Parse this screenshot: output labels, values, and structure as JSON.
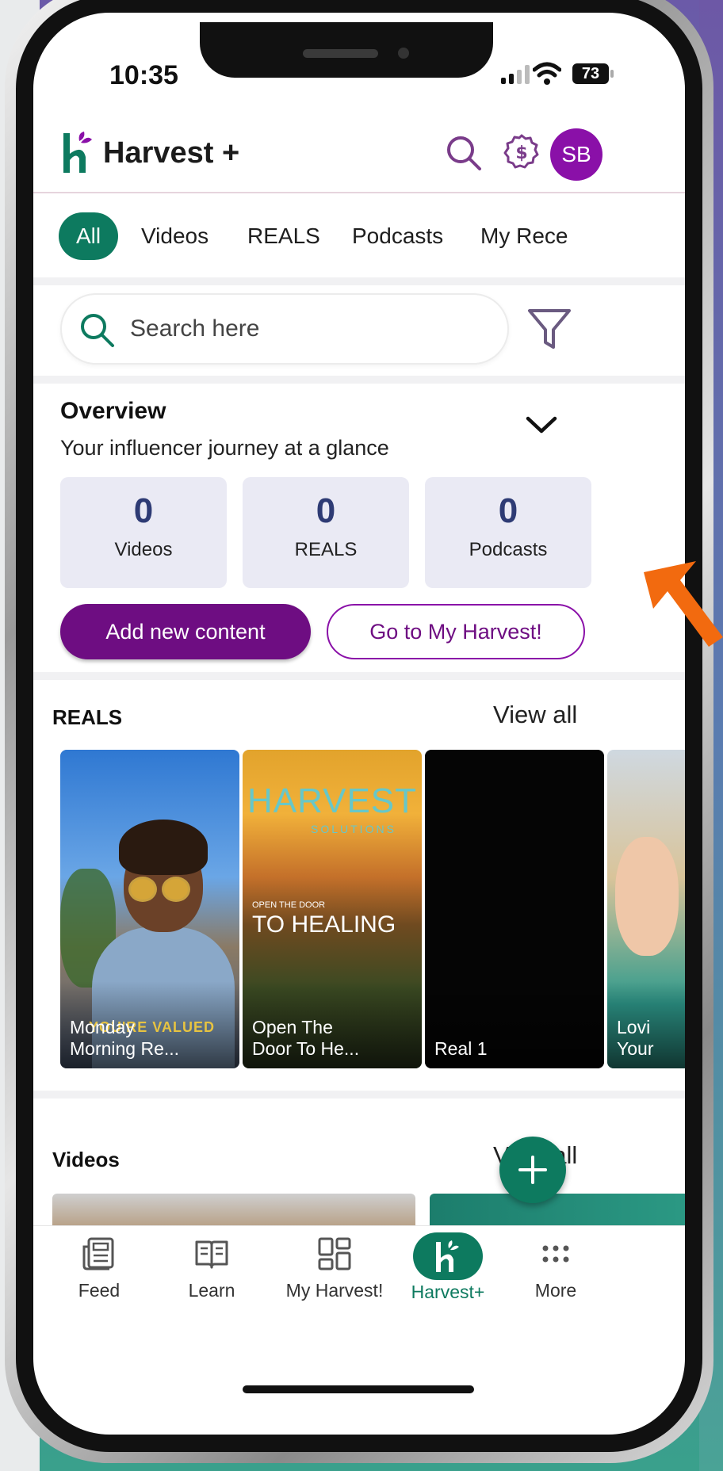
{
  "status_bar": {
    "time": "10:35",
    "battery": "73"
  },
  "header": {
    "title": "Harvest +",
    "avatar_initials": "SB"
  },
  "tabs": [
    {
      "label": "All",
      "active": true
    },
    {
      "label": "Videos"
    },
    {
      "label": "REALS"
    },
    {
      "label": "Podcasts"
    },
    {
      "label": "My Recei"
    }
  ],
  "search": {
    "placeholder": "Search here"
  },
  "overview": {
    "title": "Overview",
    "subtitle": "Your influencer journey at a glance",
    "stats": [
      {
        "value": "0",
        "label": "Videos"
      },
      {
        "value": "0",
        "label": "REALS"
      },
      {
        "value": "0",
        "label": "Podcasts"
      }
    ],
    "primary_button": "Add new content",
    "secondary_button": "Go to My Harvest!"
  },
  "reals": {
    "title": "REALS",
    "view_all": "View all",
    "cards": [
      {
        "caption": "Monday\nMorning Re...",
        "overlay": "YOU'RE VALUED"
      },
      {
        "caption": "Open The\nDoor To He...",
        "brand": "HARVEST",
        "brand_sub": "SOLUTIONS",
        "pre": "OPEN THE DOOR",
        "headline": "TO HEALING"
      },
      {
        "caption": "Real 1"
      },
      {
        "caption": "Lovi\nYour"
      }
    ]
  },
  "videos": {
    "title": "Videos",
    "view_all": "View all"
  },
  "bottom_nav": [
    {
      "label": "Feed",
      "icon": "feed-icon"
    },
    {
      "label": "Learn",
      "icon": "book-icon"
    },
    {
      "label": "My Harvest!",
      "icon": "grid-icon"
    },
    {
      "label": "Harvest+",
      "icon": "harvest-logo-icon",
      "active": true
    },
    {
      "label": "More",
      "icon": "more-icon"
    }
  ],
  "colors": {
    "brand_green": "#0d7a5f",
    "brand_purple": "#6e0d82",
    "avatar_purple": "#8a10a8",
    "stat_number": "#2e3b74",
    "annotation_arrow": "#f26a0f"
  }
}
